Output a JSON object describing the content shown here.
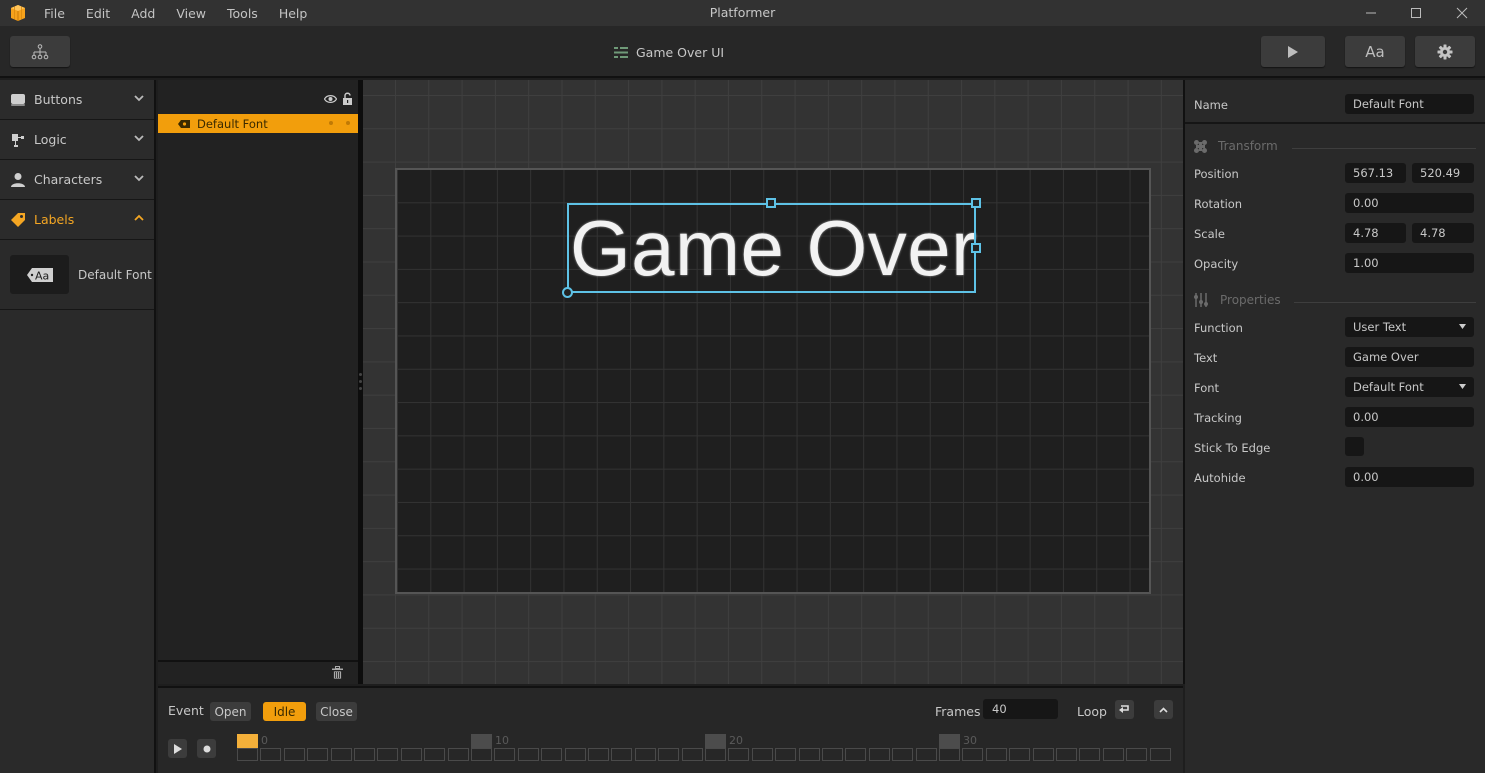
{
  "window": {
    "title": "Platformer",
    "menu": [
      "File",
      "Edit",
      "Add",
      "View",
      "Tools",
      "Help"
    ],
    "controls": [
      "minimize",
      "maximize",
      "close"
    ]
  },
  "toolbar": {
    "hierarchy_icon": "hierarchy-icon",
    "document_title": "Game Over UI",
    "document_icon": "ui-layout-icon",
    "play_icon": "play-icon",
    "font_button_label": "Aa",
    "settings_icon": "gear-icon"
  },
  "palette": {
    "categories": [
      {
        "label": "Buttons",
        "icon": "button-icon",
        "expanded": false
      },
      {
        "label": "Logic",
        "icon": "logic-icon",
        "expanded": false
      },
      {
        "label": "Characters",
        "icon": "person-icon",
        "expanded": false
      },
      {
        "label": "Labels",
        "icon": "tag-icon",
        "expanded": true
      }
    ],
    "labels_assets": [
      {
        "label": "Default Font",
        "thumb_text": "Aa"
      }
    ]
  },
  "layers": {
    "header_icons": [
      "eye-icon",
      "lock-icon"
    ],
    "items": [
      {
        "name": "Default Font",
        "icon": "label-icon",
        "selected": true
      }
    ],
    "footer_icon": "trash-icon"
  },
  "canvas": {
    "label_text": "Game Over",
    "selection_color": "#5ec2e6"
  },
  "inspector": {
    "name_label": "Name",
    "name_value": "Default Font",
    "transform": {
      "title": "Transform",
      "position_label": "Position",
      "position_x": "567.13",
      "position_y": "520.49",
      "rotation_label": "Rotation",
      "rotation": "0.00",
      "scale_label": "Scale",
      "scale_x": "4.78",
      "scale_y": "4.78",
      "opacity_label": "Opacity",
      "opacity": "1.00"
    },
    "properties": {
      "title": "Properties",
      "function_label": "Function",
      "function_value": "User Text",
      "text_label": "Text",
      "text_value": "Game Over",
      "font_label": "Font",
      "font_value": "Default Font",
      "tracking_label": "Tracking",
      "tracking_value": "0.00",
      "stick_label": "Stick To Edge",
      "stick_checked": false,
      "autohide_label": "Autohide",
      "autohide_value": "0.00"
    }
  },
  "timeline": {
    "event_label": "Event",
    "events": [
      {
        "label": "Open",
        "active": false
      },
      {
        "label": "Idle",
        "active": true
      },
      {
        "label": "Close",
        "active": false
      }
    ],
    "frames_label": "Frames",
    "frames_value": "40",
    "loop_label": "Loop",
    "current_frame": 0,
    "total_frames": 40,
    "frame_markers": [
      "0",
      "10",
      "20",
      "30"
    ]
  },
  "colors": {
    "accent": "#f29e0c",
    "selection": "#5ec2e6"
  }
}
